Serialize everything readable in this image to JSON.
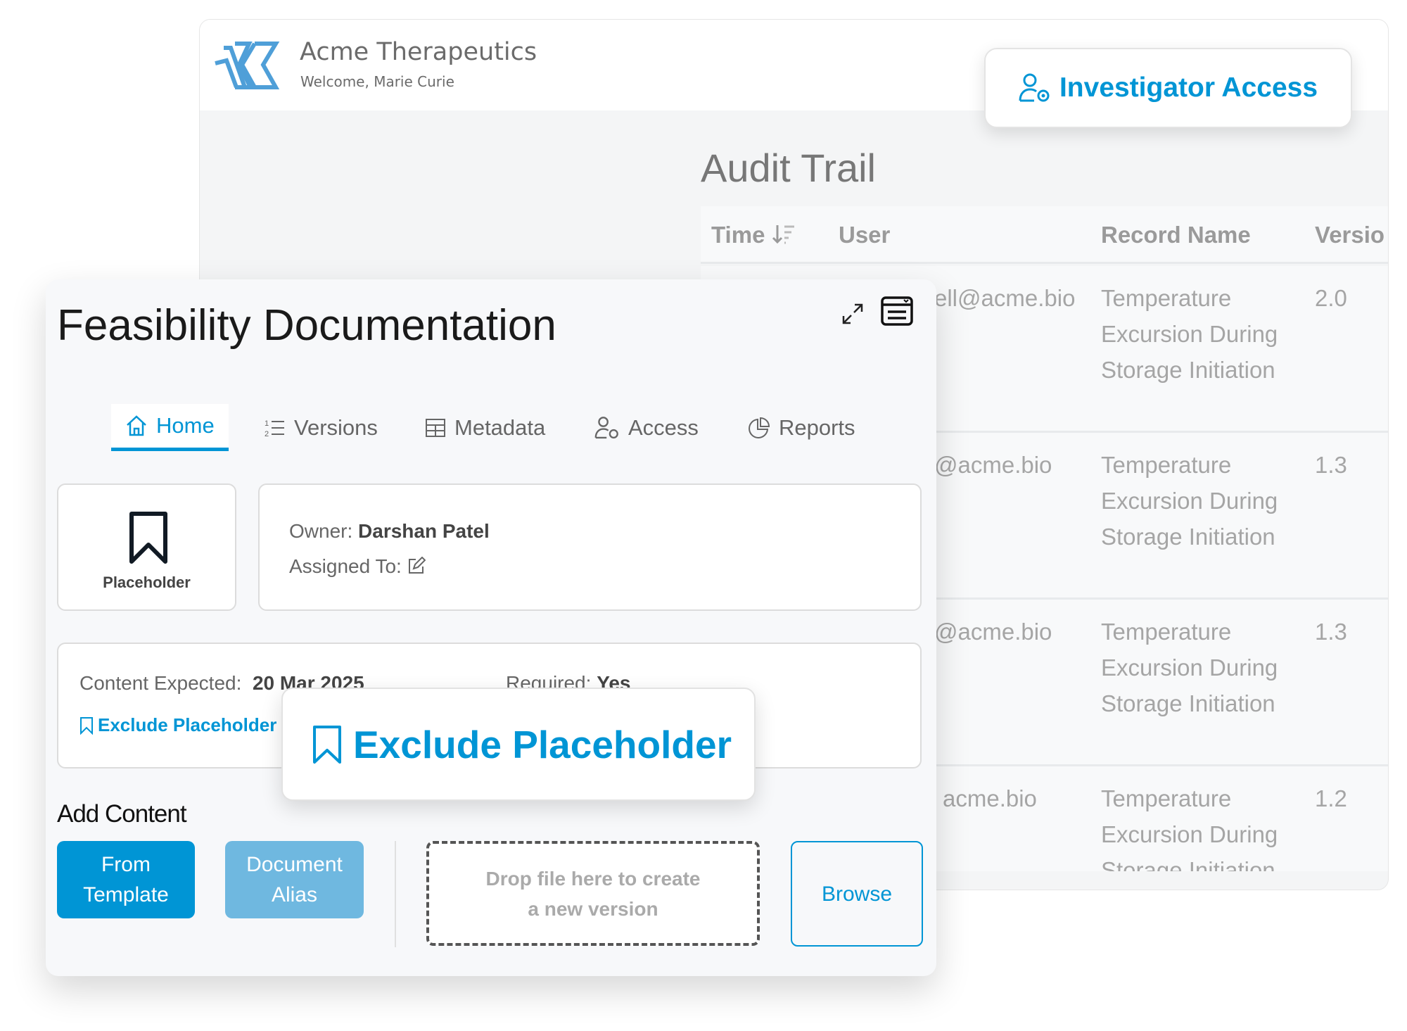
{
  "app": {
    "brand": "Acme Therapeutics",
    "welcome": "Welcome, Marie Curie",
    "logo_icon": "acme-k-logo",
    "brand_color": "#0095d5"
  },
  "investigator_access": {
    "label": "Investigator Access",
    "icon": "user-gear-icon"
  },
  "audit_trail": {
    "title": "Audit Trail",
    "columns": [
      "Time",
      "User",
      "Record Name",
      "Versio"
    ],
    "rows": [
      {
        "user": "ell@acme.bio",
        "record": [
          "Temperature",
          "Excursion During",
          "Storage Initiation"
        ],
        "version": "2.0"
      },
      {
        "user": "@acme.bio",
        "record": [
          "Temperature",
          "Excursion During",
          "Storage Initiation"
        ],
        "version": "1.3"
      },
      {
        "user": "@acme.bio",
        "record": [
          "Temperature",
          "Excursion During",
          "Storage Initiation"
        ],
        "version": "1.3"
      },
      {
        "user": "acme.bio",
        "record": [
          "Temperature",
          "Excursion During",
          "Storage Initiation"
        ],
        "version": "1.2"
      }
    ]
  },
  "document": {
    "title": "Feasibility Documentation",
    "tabs": [
      {
        "label": "Home",
        "icon": "home-icon"
      },
      {
        "label": "Versions",
        "icon": "numbered-list-icon"
      },
      {
        "label": "Metadata",
        "icon": "table-icon"
      },
      {
        "label": "Access",
        "icon": "user-gear-icon"
      },
      {
        "label": "Reports",
        "icon": "pie-chart-icon"
      }
    ],
    "active_tab": "Home",
    "placeholder_label": "Placeholder",
    "owner_label": "Owner:",
    "owner": "Darshan Patel",
    "assigned_label": "Assigned To:",
    "content_expected_label": "Content Expected:",
    "content_expected": "20 Mar 2025",
    "required_label": "Required:",
    "required": "Yes",
    "exclude_link": "Exclude Placeholder",
    "exclude_popup": "Exclude Placeholder",
    "add_content": "Add Content",
    "from_template": [
      "From",
      "Template"
    ],
    "document_alias": [
      "Document",
      "Alias"
    ],
    "drop_zone": [
      "Drop file here to create",
      "a new version"
    ],
    "browse": "Browse"
  }
}
